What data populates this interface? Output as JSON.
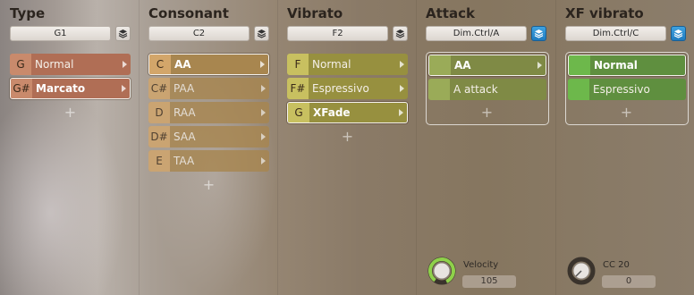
{
  "columns": [
    {
      "title": "Type",
      "selector": "G1",
      "items": [
        {
          "key": "G",
          "label": "Normal",
          "selected": false
        },
        {
          "key": "G#",
          "label": "Marcato",
          "selected": true
        }
      ]
    },
    {
      "title": "Consonant",
      "selector": "C2",
      "items": [
        {
          "key": "C",
          "label": "AA",
          "selected": true
        },
        {
          "key": "C#",
          "label": "PAA",
          "selected": false
        },
        {
          "key": "D",
          "label": "RAA",
          "selected": false
        },
        {
          "key": "D#",
          "label": "SAA",
          "selected": false
        },
        {
          "key": "E",
          "label": "TAA",
          "selected": false
        }
      ]
    },
    {
      "title": "Vibrato",
      "selector": "F2",
      "items": [
        {
          "key": "F",
          "label": "Normal",
          "selected": false
        },
        {
          "key": "F#",
          "label": "Espressivo",
          "selected": false
        },
        {
          "key": "G",
          "label": "XFade",
          "selected": true
        }
      ]
    },
    {
      "title": "Attack",
      "selector": "Dim.Ctrl/A",
      "items": [
        {
          "key": "",
          "label": "AA",
          "selected": true
        },
        {
          "key": "",
          "label": "A attack",
          "selected": false
        }
      ],
      "knob": {
        "label": "Velocity",
        "value": "105",
        "level": 0.83
      }
    },
    {
      "title": "XF vibrato",
      "selector": "Dim.Ctrl/C",
      "items": [
        {
          "key": "",
          "label": "Normal",
          "selected": true
        },
        {
          "key": "",
          "label": "Espressivo",
          "selected": false
        }
      ],
      "knob": {
        "label": "CC 20",
        "value": "0",
        "level": 0
      }
    }
  ],
  "add_symbol": "+",
  "colors": {
    "type_item": "#b06e55",
    "type_key": "#c98a6c",
    "consonant_item": "#a8864f",
    "consonant_key": "#d3a66a",
    "vibrato_item": "#97903f",
    "vibrato_key": "#c8c060",
    "attack_item": "#7f8a45",
    "attack_key": "#9aab58",
    "xf_item": "#5f8f3f",
    "xf_key": "#6db84b",
    "knob_ring": "#8fd14a",
    "layer_blue": "#2a8fd6"
  }
}
